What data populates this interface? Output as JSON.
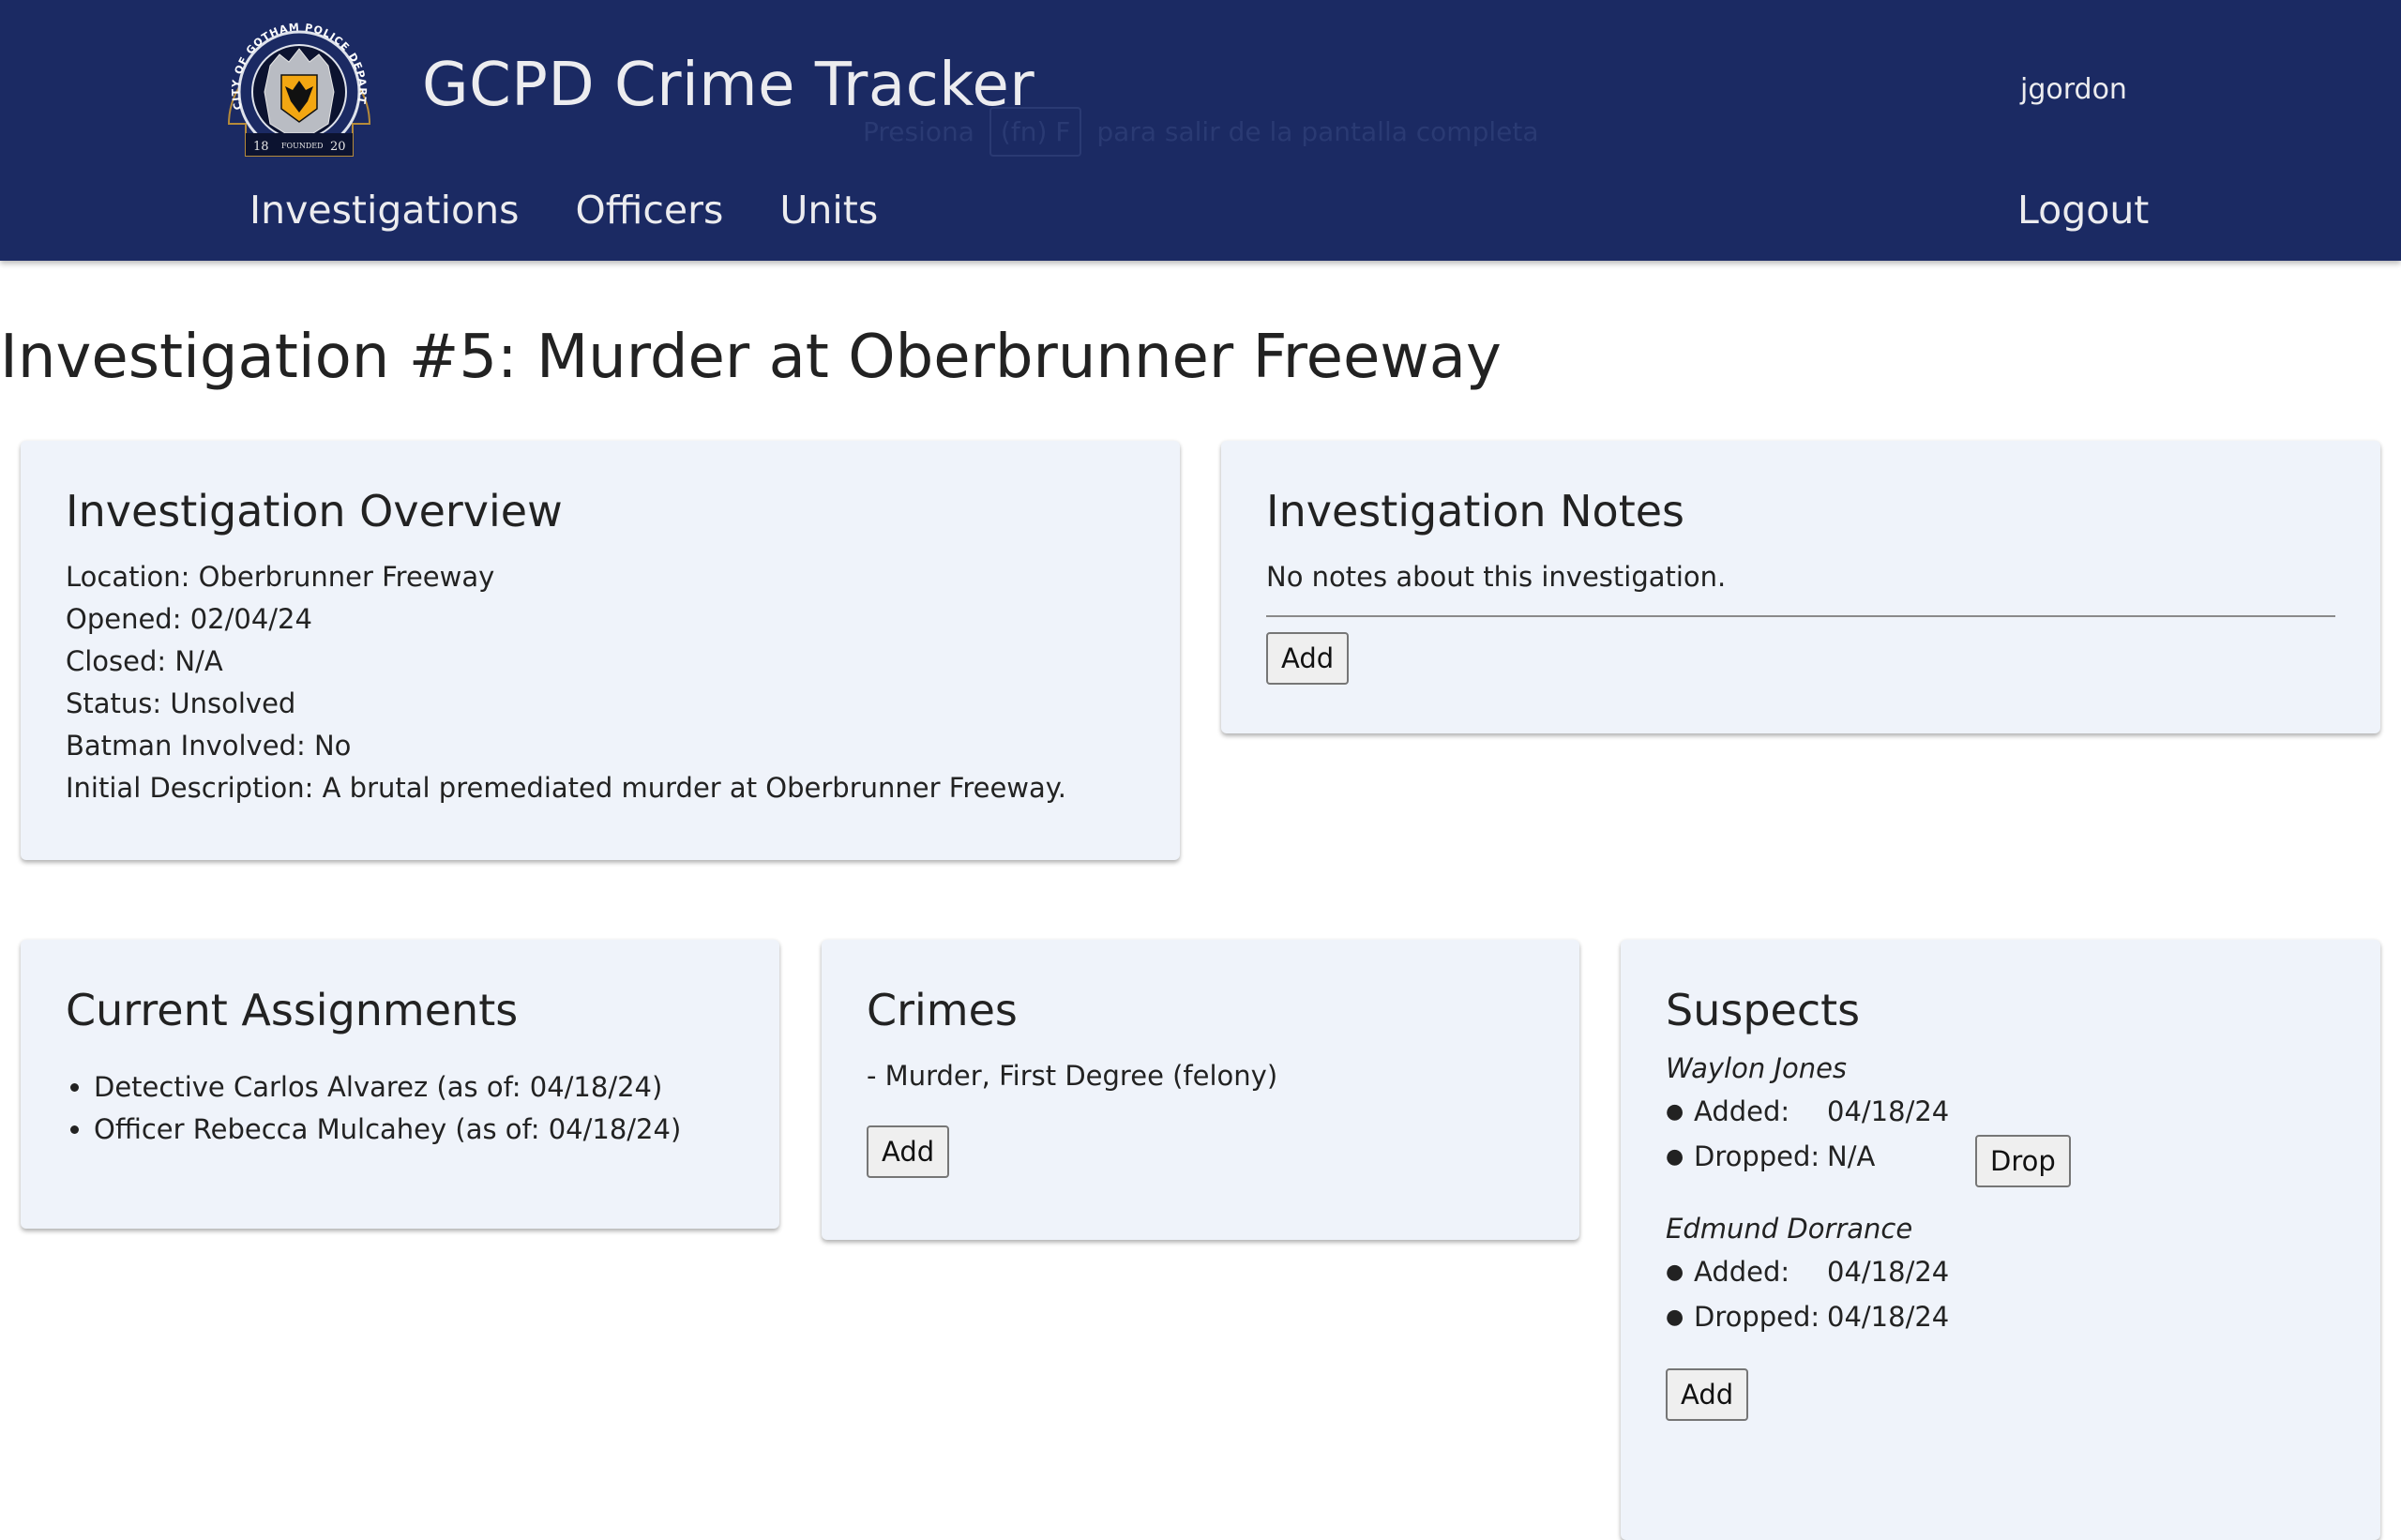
{
  "header": {
    "app_title": "GCPD Crime Tracker",
    "logo_alt": "City of Gotham Police Department seal",
    "logo_text": {
      "ring": "CITY OF GOTHAM POLICE DEPARTMENT",
      "year_left": "18",
      "year_right": "20",
      "founded": "FOUNDED"
    },
    "username": "jgordon",
    "nav": [
      {
        "label": "Investigations"
      },
      {
        "label": "Officers"
      },
      {
        "label": "Units"
      }
    ],
    "logout_label": "Logout",
    "background_color": "#1b2a63"
  },
  "fullscreen_overlay": {
    "prefix": "Presiona",
    "key": "(fn) F",
    "suffix": "para salir de la pantalla completa"
  },
  "page": {
    "title": "Investigation #5: Murder at Oberbrunner Freeway"
  },
  "overview": {
    "heading": "Investigation Overview",
    "fields": [
      {
        "text": "Location: Oberbrunner Freeway"
      },
      {
        "text": "Opened: 02/04/24"
      },
      {
        "text": "Closed: N/A"
      },
      {
        "text": "Status: Unsolved"
      },
      {
        "text": "Batman Involved: No"
      },
      {
        "text": "Initial Description: A brutal premediated murder at Oberbrunner Freeway."
      }
    ]
  },
  "notes": {
    "heading": "Investigation Notes",
    "empty_text": "No notes about this investigation.",
    "add_label": "Add"
  },
  "assignments": {
    "heading": "Current Assignments",
    "items": [
      {
        "text": "Detective Carlos Alvarez (as of: 04/18/24)"
      },
      {
        "text": "Officer Rebecca Mulcahey (as of: 04/18/24)"
      }
    ]
  },
  "crimes": {
    "heading": "Crimes",
    "items": [
      {
        "text": "- Murder, First Degree (felony)"
      }
    ],
    "add_label": "Add"
  },
  "suspects": {
    "heading": "Suspects",
    "added_label": "Added:",
    "dropped_label": "Dropped:",
    "drop_label": "Drop",
    "add_label": "Add",
    "items": [
      {
        "name": "Waylon Jones",
        "added": "04/18/24",
        "dropped": "N/A"
      },
      {
        "name": "Edmund Dorrance",
        "added": "04/18/24",
        "dropped": "04/18/24"
      }
    ]
  }
}
